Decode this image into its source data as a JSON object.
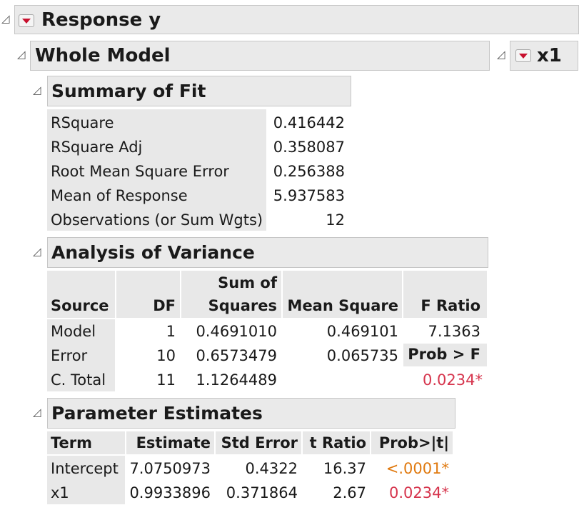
{
  "response": {
    "title": "Response y"
  },
  "whole_model": {
    "title": "Whole Model"
  },
  "x1_panel": {
    "title": "x1"
  },
  "summary_of_fit": {
    "title": "Summary of Fit",
    "rows": [
      {
        "label": "RSquare",
        "value": "0.416442"
      },
      {
        "label": "RSquare Adj",
        "value": "0.358087"
      },
      {
        "label": "Root Mean Square Error",
        "value": "0.256388"
      },
      {
        "label": "Mean of Response",
        "value": "5.937583"
      },
      {
        "label": "Observations (or Sum Wgts)",
        "value": "12"
      }
    ]
  },
  "anova": {
    "title": "Analysis of Variance",
    "headers": {
      "source": "Source",
      "df": "DF",
      "ss_line1": "Sum of",
      "ss_line2": "Squares",
      "ms": "Mean Square",
      "f": "F Ratio",
      "prob_label": "Prob > F"
    },
    "rows": [
      {
        "source": "Model",
        "df": "1",
        "ss": "0.4691010",
        "ms": "0.469101",
        "f": "7.1363"
      },
      {
        "source": "Error",
        "df": "10",
        "ss": "0.6573479",
        "ms": "0.065735"
      },
      {
        "source": "C. Total",
        "df": "11",
        "ss": "1.1264489",
        "prob": "0.0234*"
      }
    ]
  },
  "parameter_estimates": {
    "title": "Parameter Estimates",
    "headers": {
      "term": "Term",
      "estimate": "Estimate",
      "std_error": "Std Error",
      "t_ratio": "t Ratio",
      "prob": "Prob>|t|"
    },
    "rows": [
      {
        "term": "Intercept",
        "estimate": "7.0750973",
        "std_error": "0.4322",
        "t_ratio": "16.37",
        "prob": "<.0001*"
      },
      {
        "term": "x1",
        "estimate": "0.9933896",
        "std_error": "0.371864",
        "t_ratio": "2.67",
        "prob": "0.0234*"
      }
    ]
  },
  "colors": {
    "significant_red": "#d6354d",
    "highly_significant_orange": "#e07a10",
    "header_gray": "#eaeaea"
  },
  "icons": {
    "disclosure": "disclosure-triangle-icon",
    "menu": "red-triangle-menu-icon"
  }
}
